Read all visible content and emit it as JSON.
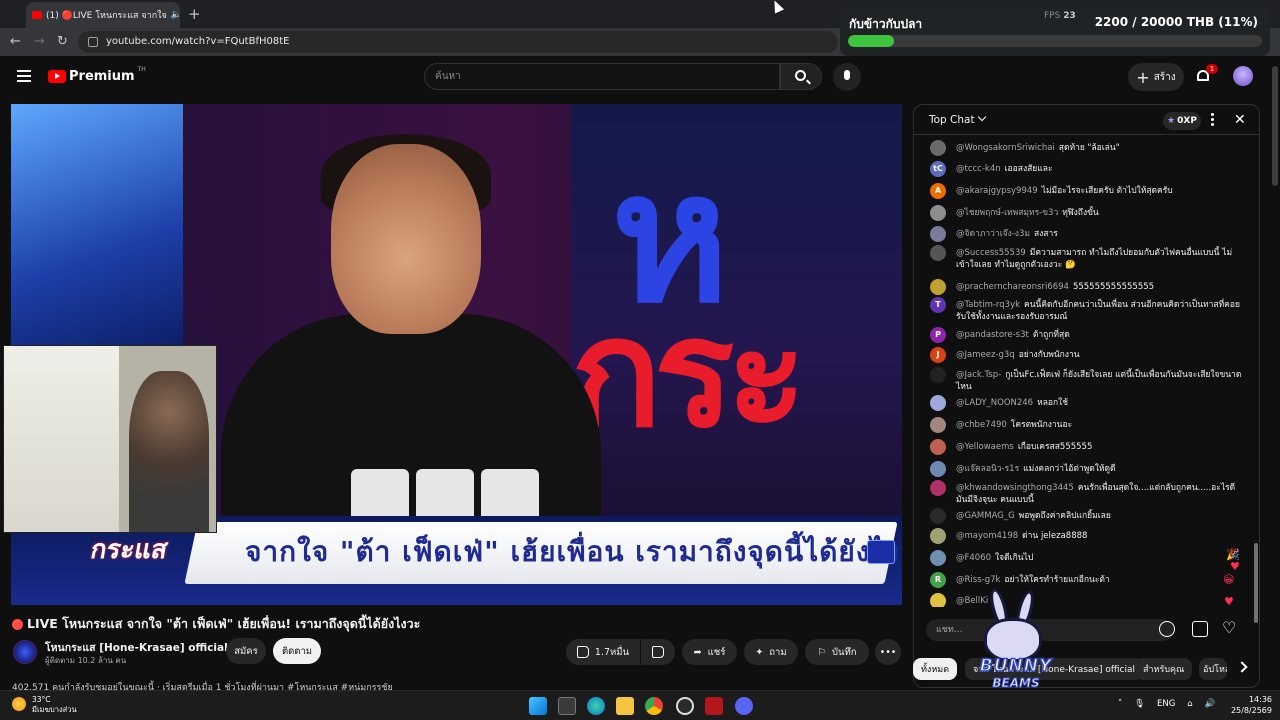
{
  "browser": {
    "tab_title": "(1) 🔴LIVE โหนกระแส จากใจ",
    "url": "youtube.com/watch?v=FQutBfH08tE"
  },
  "overlay": {
    "title": "กับข้าวกับปลา",
    "amount": "2200 / 20000 THB (11%)",
    "progress": 0.11,
    "fps_label": "FPS",
    "fps_value": "23"
  },
  "header": {
    "logo_text": "Premium",
    "logo_suffix": "TH",
    "search_placeholder": "ค้นหา",
    "create_label": "สร้าง",
    "notif_count": "1"
  },
  "video": {
    "caption": "จากใจ \"ต้า เฟ็ดเฟ่\" เฮ้ยเพื่อน เรามาถึงจุดนี้ได้ยังไงวะ",
    "show_badge": "กระแส"
  },
  "info": {
    "title": "LIVE โหนกระแส จากใจ \"ต้า เฟ็ดเฟ่\" เฮ้ยเพื่อน! เรามาถึงจุดนี้ได้ยังไงวะ",
    "channel": "โหนกระแส [Hone-Krasae] official",
    "subscribers": "ผู้ติดตาม 10.2 ล้าน คน",
    "join_label": "สมัคร",
    "subscribe_label": "ติดตาม",
    "like_count": "1.7หมื่น",
    "share_label": "แชร์",
    "ask_label": "ถาม",
    "save_label": "บันทึก",
    "desc_preview": "402,571 คนกำลังรับชมอยู่ในขณะนี้ · เริ่มสตรีมเมื่อ 1 ชั่วโมงที่ผ่านมา #โหนกระแส #หนุ่มกรรชัย"
  },
  "chat": {
    "mode_label": "Top Chat",
    "xp_label": "0XP",
    "input_placeholder": "แชท...",
    "messages": [
      {
        "author": "@WongsakornSriwichai",
        "text": "สุดท้าย \"ล้อเล่น\"",
        "color": "#6a6a6a",
        "initial": ""
      },
      {
        "author": "@tccc-k4n",
        "text": "เออสงสัยและ",
        "color": "#5c6bc0",
        "initial": "tC"
      },
      {
        "author": "@akarajgypsy9949",
        "text": "ไม่มีอะไรจะเสียครับ ต้าไปให้สุดครับ",
        "color": "#ef6c00",
        "initial": "A"
      },
      {
        "author": "@ไชยพฤกษ์-เทพสมุทร-ข3ว",
        "text": "ทุฬิงถึงขั้น",
        "color": "#8d8d8d",
        "initial": ""
      },
      {
        "author": "@จิดาภาว่าเจ๊ง-ง3ม",
        "text": "สงสาร",
        "color": "#7a7a9a",
        "initial": ""
      },
      {
        "author": "@Success55539",
        "text": "มีความสามารถ ทำไมถึงไปยอมกับตัวไฟคนอื่นแบบนี้ ไม่เข้าใจเลย ทำไมดูถูกตัวเองวะ 🤔",
        "color": "#555555",
        "initial": ""
      },
      {
        "author": "@prachernchareonsri6694",
        "text": "555555555555555",
        "color": "#c0a030",
        "initial": ""
      },
      {
        "author": "@Tabtim-rq3yk",
        "text": "คนนี้คิดกับอีกคนว่าเป็นเพื่อน ส่วนอีกคนคิดว่าเป็นทาสที่คอยรับใช้ทั้งงานและรองรับอารมณ์",
        "color": "#5e35b1",
        "initial": "T"
      },
      {
        "author": "@pandastore-s3t",
        "text": "ต้าถูกที่สุด",
        "color": "#8e24aa",
        "initial": "P"
      },
      {
        "author": "@Jameez-g3q",
        "text": "อย่างกับพนักงาน",
        "color": "#d84315",
        "initial": "J"
      },
      {
        "author": "@Jack.Tsp-",
        "text": "กูเป็นFc.เฟ็ดเฟ่ ก็ยังเสียใจเลย แต่นี้เป็นเพื่อนกันมันจะเสียใจขนาดไหน",
        "color": "#222222",
        "initial": ""
      },
      {
        "author": "@LADY_NOON246",
        "text": "หลอกใช้",
        "color": "#9fa8da",
        "initial": ""
      },
      {
        "author": "@chbe7490",
        "text": "โครตพนักงานอะ",
        "color": "#a1887f",
        "initial": ""
      },
      {
        "author": "@Yellowaems",
        "text": "เกือบเครสส555555",
        "color": "#c06050",
        "initial": ""
      },
      {
        "author": "@แจ๊คลอนิว-ร1ร",
        "text": "แม่งคลกว่าไอ้ต่าพูดให้ดูดี",
        "color": "#6d8bb0",
        "initial": ""
      },
      {
        "author": "@khwandowsingthong3445",
        "text": "คนรักเพื่อนสุดใจ....แต่กลับถูกคน.....อะไรดีมันมีจิงจุนะ คนแบบนี้",
        "color": "#b0306a",
        "initial": ""
      },
      {
        "author": "@GAMMAG_G",
        "text": "พอพูดถึงค่าคลิปแกยิ้มเลย",
        "color": "#2a2a2a",
        "initial": ""
      },
      {
        "author": "@mayom4198",
        "text": "ด่าน jeleza8888",
        "color": "#a0a070",
        "initial": ""
      },
      {
        "author": "@F4060",
        "text": "ใจดีเกินไป",
        "color": "#7090b0",
        "initial": ""
      },
      {
        "author": "@Riss-g7k",
        "text": "อย่าให้ใครทำร้ายแกอีกนะต้า",
        "color": "#43a047",
        "initial": "R"
      },
      {
        "author": "@BellKi",
        "text": "",
        "color": "#e0c040",
        "initial": ""
      }
    ]
  },
  "chips": [
    "ทั้งหมด",
    "จาก โหนกระแส [Hone-Krasae] official",
    "สำหรับคุณ",
    "อัปโหลด"
  ],
  "watermark": {
    "line1": "BUNNY",
    "line2": "BEAMS"
  },
  "taskbar": {
    "temp": "33°C",
    "weather_desc": "มีเมฆบางส่วน",
    "lang": "ENG",
    "time": "14:36",
    "date": "25/8/2569"
  }
}
